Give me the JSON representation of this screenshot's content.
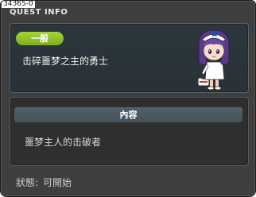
{
  "window": {
    "quest_id": "34365-0",
    "title": "QUEST INFO"
  },
  "quest": {
    "category": "一般",
    "name": "击碎噩梦之主的勇士"
  },
  "content": {
    "header": "內容",
    "text": "噩梦主人的击破者"
  },
  "status": {
    "label": "狀態:",
    "value": "可開始"
  },
  "colors": {
    "window_bg": "#3f3f3f",
    "category_badge": "#8fbf28",
    "content_header": "#4b5963"
  },
  "icons": {
    "npc": "npc-nurse-girl-icon"
  }
}
